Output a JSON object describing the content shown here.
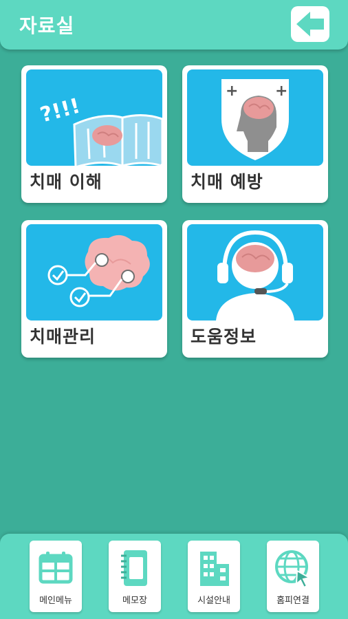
{
  "header": {
    "title": "자료실",
    "back_icon": "back-arrow-icon"
  },
  "cards": [
    {
      "label": "치매 이해",
      "icon": "open-book-brain-icon"
    },
    {
      "label": "치매 예방",
      "icon": "shield-head-icon"
    },
    {
      "label": "치매관리",
      "icon": "brain-checklist-icon"
    },
    {
      "label": "도움정보",
      "icon": "headset-person-icon"
    }
  ],
  "bottom_nav": [
    {
      "label": "메인메뉴",
      "icon": "calendar-icon"
    },
    {
      "label": "메모장",
      "icon": "notebook-icon"
    },
    {
      "label": "시설안내",
      "icon": "building-icon"
    },
    {
      "label": "홈피연결",
      "icon": "globe-cursor-icon"
    }
  ],
  "colors": {
    "background": "#3cae98",
    "bar": "#5dd8c1",
    "tile": "#23b8e8",
    "brain": "#e79a9a"
  }
}
